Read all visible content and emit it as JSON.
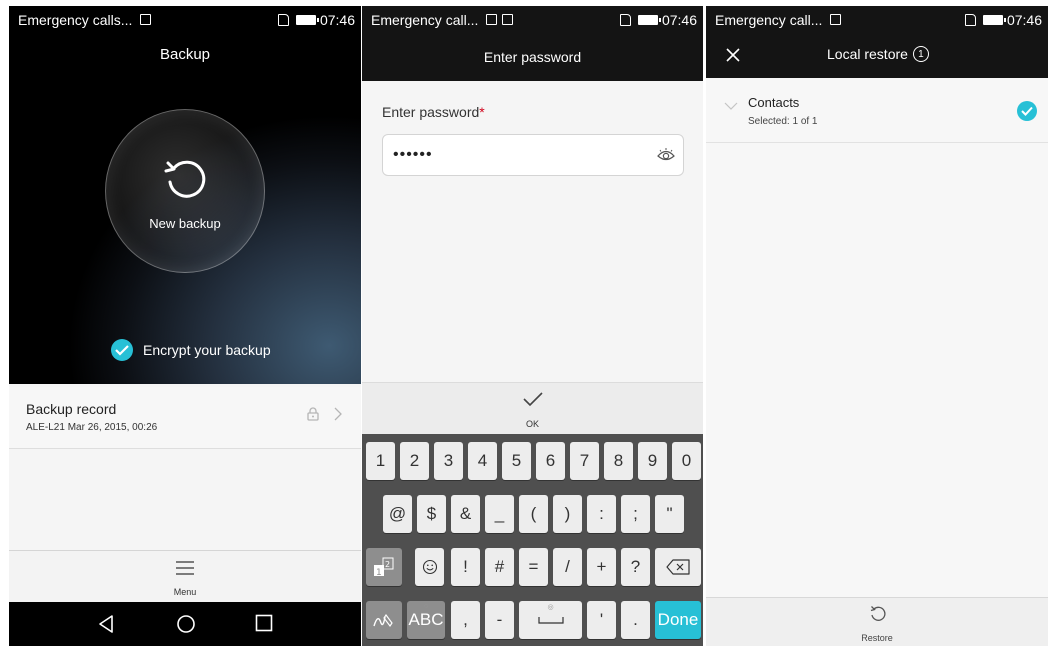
{
  "colors": {
    "accent": "#27c0d6",
    "required": "#d0021b",
    "statusbar": "#141414",
    "keyboard": "#4f4f4f"
  },
  "status_bar": {
    "screen1_text": "Emergency calls...",
    "screen2_text": "Emergency call...",
    "screen3_text": "Emergency call...",
    "time": "07:46"
  },
  "backup_screen": {
    "title": "Backup",
    "new_backup_label": "New backup",
    "encrypt_label": "Encrypt your backup",
    "encrypt_checked": true,
    "record_title": "Backup record",
    "record_subtitle": "ALE-L21  Mar 26, 2015, 00:26",
    "menu_label": "Menu",
    "icons": {
      "new_backup": "refresh-icon",
      "lock": "lock-icon",
      "chevron": "chevron-right-icon",
      "menu": "menu-icon"
    }
  },
  "password_screen": {
    "title": "Enter password",
    "field_label": "Enter password",
    "required_mark": "*",
    "password_value": "••••••",
    "ok_label": "OK",
    "keyboard": {
      "row1": [
        "1",
        "2",
        "3",
        "4",
        "5",
        "6",
        "7",
        "8",
        "9",
        "0"
      ],
      "row2": [
        "@",
        "$",
        "&",
        "_",
        "(",
        ")",
        ":",
        ";",
        "\""
      ],
      "row3_symbols": [
        "!",
        "#",
        "=",
        "/",
        "+",
        "?"
      ],
      "abc_label": "ABC",
      "comma": ",",
      "dash": "-",
      "apostrophe": "'",
      "period": ".",
      "done_label": "Done"
    }
  },
  "restore_screen": {
    "title": "Local restore",
    "badge": "1",
    "item_title": "Contacts",
    "item_subtitle": "Selected: 1 of 1",
    "item_checked": true,
    "restore_label": "Restore"
  }
}
